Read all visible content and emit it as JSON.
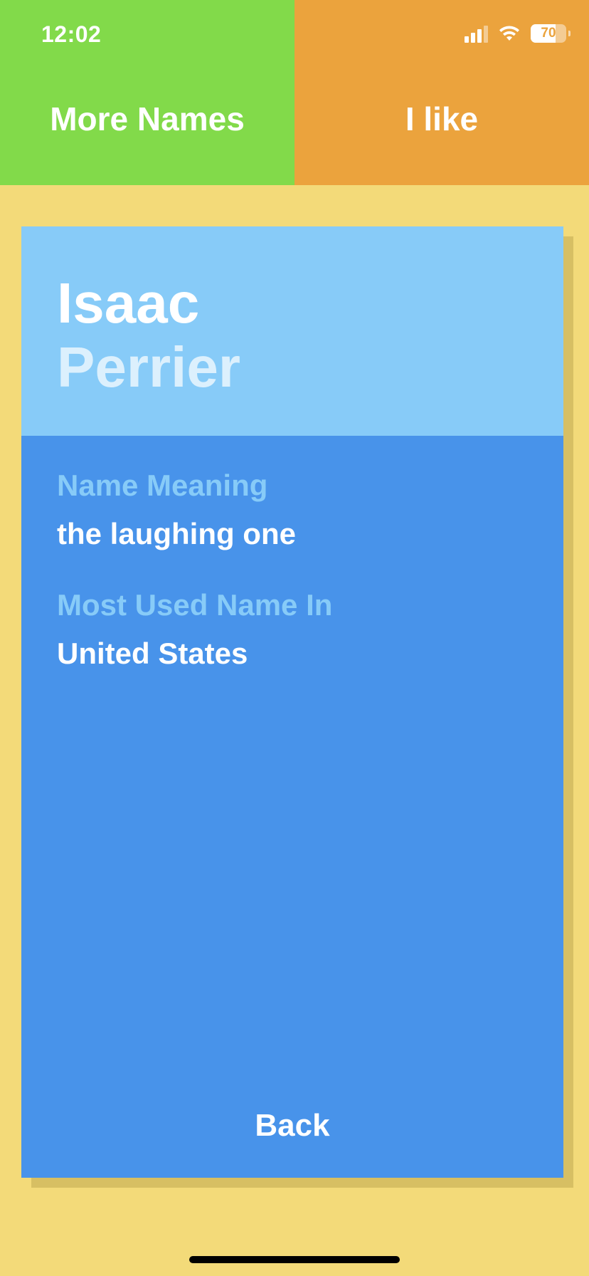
{
  "status_bar": {
    "time": "12:02",
    "battery_level": "70",
    "icons": [
      "cellular-signal-icon",
      "wifi-icon",
      "battery-icon"
    ]
  },
  "top_actions": {
    "more_names_label": "More Names",
    "like_label": "I like"
  },
  "card": {
    "first_name": "Isaac",
    "last_name": "Perrier",
    "fields": [
      {
        "label": "Name Meaning",
        "value": "the laughing one"
      },
      {
        "label": "Most Used Name In",
        "value": "United States"
      }
    ],
    "back_label": "Back"
  },
  "colors": {
    "background": "#F3DA79",
    "more_names_bg": "#82DA4A",
    "like_bg": "#EBA33D",
    "card_header_bg": "#87CBF8",
    "card_body_bg": "#4893EA",
    "label_color": "#87CBF8",
    "last_name_color": "#DCF0FD"
  }
}
